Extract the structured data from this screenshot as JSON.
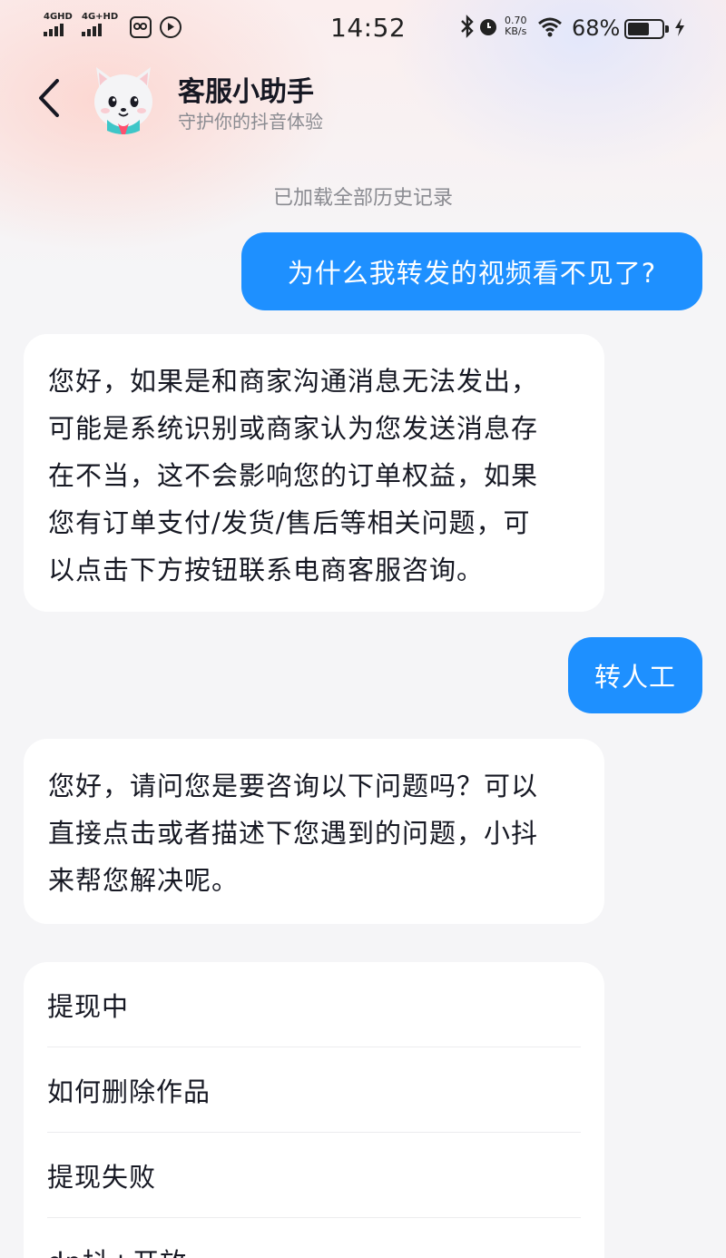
{
  "status_bar": {
    "signal_1_label": "4GHD",
    "signal_2_label": "4G+HD",
    "time": "14:52",
    "net_speed_value": "0.70",
    "net_speed_unit": "KB/s",
    "battery_text": "68%",
    "battery_level": 0.68
  },
  "header": {
    "back_icon": "chevron-left-icon",
    "avatar_icon": "cat-mascot-avatar",
    "title": "客服小助手",
    "subtitle": "守护你的抖音体验"
  },
  "chat": {
    "history_tip": "已加载全部历史记录",
    "messages": [
      {
        "from": "user",
        "text": "为什么我转发的视频看不见了?"
      },
      {
        "from": "bot",
        "lines": [
          "您好，如果是和商家沟通消息无法发出，",
          "可能是系统识别或商家认为您发送消息存",
          "在不当，这不会影响您的订单权益，如果",
          "您有订单支付/发货/售后等相关问题，可",
          "以点击下方按钮联系电商客服咨询。"
        ]
      },
      {
        "from": "user",
        "text": "转人工"
      },
      {
        "from": "bot",
        "lines": [
          "您好，请问您是要咨询以下问题吗？可以",
          "直接点击或者描述下您遇到的问题，小抖",
          "来帮您解决呢。"
        ]
      }
    ],
    "options": [
      "提现中",
      "如何删除作品",
      "提现失败",
      "dp抖+开放"
    ]
  },
  "colors": {
    "user_bubble": "#1e90ff",
    "bot_bubble": "#ffffff",
    "background": "#f5f5f7"
  }
}
